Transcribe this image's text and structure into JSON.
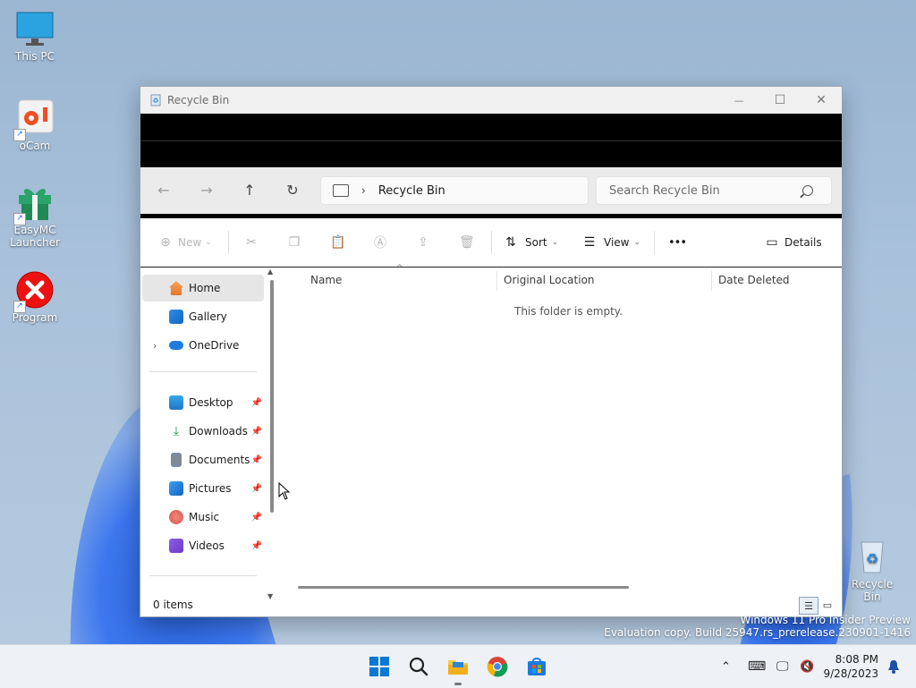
{
  "desktop": {
    "icons": [
      {
        "label": "This PC"
      },
      {
        "label": "oCam"
      },
      {
        "label": "EasyMC Launcher"
      },
      {
        "label": "Program"
      },
      {
        "label": "Recycle Bin"
      }
    ]
  },
  "window": {
    "title": "Recycle Bin",
    "controls": {
      "minimize": "—",
      "maximize": "☐",
      "close": "✕"
    },
    "address": {
      "crumb": "Recycle Bin",
      "separator": "›"
    },
    "search": {
      "placeholder": "Search Recycle Bin"
    },
    "toolbar": {
      "new_label": "New",
      "sort_label": "Sort",
      "view_label": "View",
      "more_label": "•••",
      "details_label": "Details"
    },
    "sidebar": {
      "top": [
        {
          "label": "Home"
        },
        {
          "label": "Gallery"
        },
        {
          "label": "OneDrive"
        }
      ],
      "quick_access": [
        {
          "label": "Desktop"
        },
        {
          "label": "Downloads"
        },
        {
          "label": "Documents"
        },
        {
          "label": "Pictures"
        },
        {
          "label": "Music"
        },
        {
          "label": "Videos"
        }
      ]
    },
    "columns": [
      "Name",
      "Original Location",
      "Date Deleted"
    ],
    "empty_message": "This folder is empty.",
    "status": {
      "item_count": "0 items"
    }
  },
  "watermark": {
    "line1": "Windows 11 Pro Insider Preview",
    "line2": "Evaluation copy. Build 25947.rs_prerelease.230901-1416"
  },
  "taskbar": {
    "time": "8:08 PM",
    "date": "9/28/2023"
  },
  "colors": {
    "accent": "#0067c0",
    "titlebar": "#f0f0f0",
    "address_bg": "#ebebeb",
    "taskbar": "#eef1f6"
  }
}
